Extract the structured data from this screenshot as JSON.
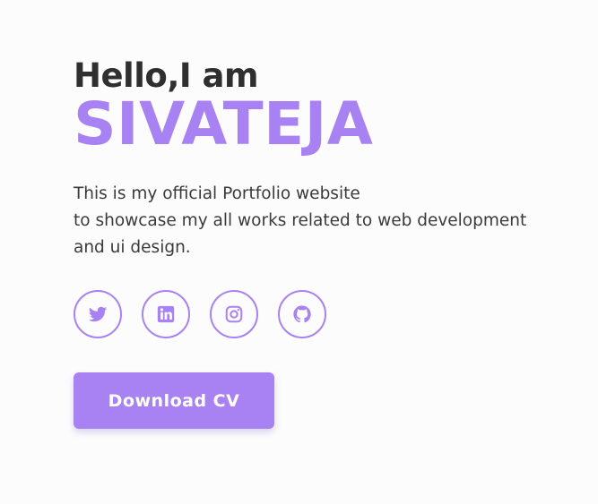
{
  "hero": {
    "greeting": "Hello,I am",
    "name": "SIVATEJA",
    "intro_lines": [
      "This is my official Portfolio website",
      "to showcase my all works related to web development",
      "and ui design."
    ]
  },
  "socials": [
    {
      "icon": "twitter-icon"
    },
    {
      "icon": "linkedin-icon"
    },
    {
      "icon": "instagram-icon"
    },
    {
      "icon": "github-icon"
    }
  ],
  "cta": {
    "download_label": "Download CV"
  },
  "colors": {
    "accent": "#a882f3",
    "heading": "#2f2f2f",
    "text": "#3a3a3a",
    "background": "#fcfcfd"
  }
}
